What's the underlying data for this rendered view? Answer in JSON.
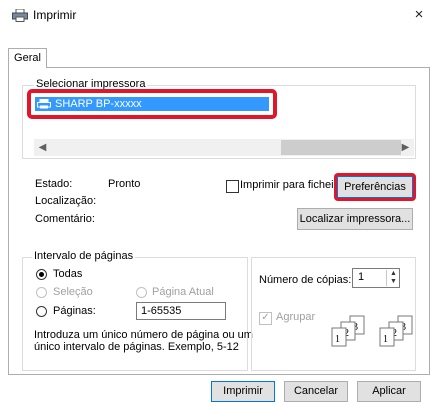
{
  "window": {
    "title": "Imprimir",
    "close_glyph": "×"
  },
  "tabs": [
    {
      "label": "Geral"
    }
  ],
  "printer": {
    "group_label": "Selecionar impressora",
    "items": [
      {
        "label": "SHARP BP-xxxxx",
        "selected": true
      }
    ],
    "status_label": "Estado:",
    "status_value": "Pronto",
    "location_label": "Localização:",
    "comment_label": "Comentário:",
    "print_to_file_label": "Imprimir para ficheiro",
    "print_to_file_checked": false,
    "preferences_label": "Preferências",
    "find_printer_label": "Localizar impressora..."
  },
  "page_range": {
    "group_label": "Intervalo de páginas",
    "all_label": "Todas",
    "selection_label": "Seleção",
    "current_page_label": "Página Atual",
    "pages_label": "Páginas:",
    "pages_value": "1-65535",
    "selected_option": "all",
    "hint_line1": "Introduza um único número de página ou um",
    "hint_line2": "único intervalo de páginas. Exemplo, 5-12"
  },
  "copies": {
    "label": "Número de cópias:",
    "value": "1",
    "collate_label": "Agrupar",
    "collate_checked": true,
    "collate_disabled": true
  },
  "buttons": {
    "print": "Imprimir",
    "cancel": "Cancelar",
    "apply": "Aplicar"
  },
  "colors": {
    "selection": "#3399ff",
    "highlight": "#e0162b",
    "default_button_border": "#0078d7"
  }
}
